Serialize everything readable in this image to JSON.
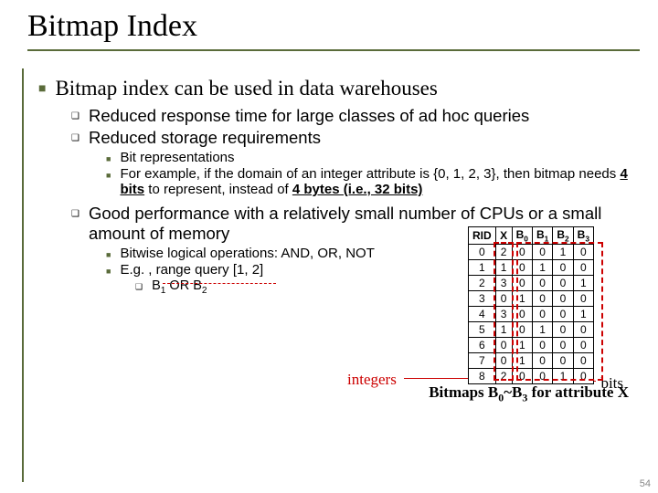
{
  "title": "Bitmap Index",
  "point1": "Bitmap index can be used in data warehouses",
  "sub1": "Reduced response time for large classes of ad hoc queries",
  "sub2": "Reduced storage requirements",
  "sub2a": "Bit representations",
  "sub2b_pre": "For example, if the domain of an integer attribute is {0, 1, 2, 3}, then bitmap needs ",
  "sub2b_mid": "4 bits",
  "sub2b_mid2": " to represent, instead of ",
  "sub2b_end": "4 bytes (i.e., 32 bits)",
  "sub3": "Good performance with a relatively small number of CPUs or a small amount of memory",
  "sub3a": "Bitwise logical operations: AND, OR, NOT",
  "sub3b": "E.g. , range query [1, 2]",
  "sub3b1_pre": "B",
  "sub3b1_or": " OR ",
  "sub3b1_b2": "B",
  "label_integers": "integers",
  "label_bits": "bits",
  "table": {
    "headers": [
      "RID",
      "X",
      "B",
      "B",
      "B",
      "B"
    ],
    "header_subs": [
      "",
      "",
      "0",
      "1",
      "2",
      "3"
    ],
    "rows": [
      [
        "0",
        "2",
        "0",
        "0",
        "1",
        "0"
      ],
      [
        "1",
        "1",
        "0",
        "1",
        "0",
        "0"
      ],
      [
        "2",
        "3",
        "0",
        "0",
        "0",
        "1"
      ],
      [
        "3",
        "0",
        "1",
        "0",
        "0",
        "0"
      ],
      [
        "4",
        "3",
        "0",
        "0",
        "0",
        "1"
      ],
      [
        "5",
        "1",
        "0",
        "1",
        "0",
        "0"
      ],
      [
        "6",
        "0",
        "1",
        "0",
        "0",
        "0"
      ],
      [
        "7",
        "0",
        "1",
        "0",
        "0",
        "0"
      ],
      [
        "8",
        "2",
        "0",
        "0",
        "1",
        "0"
      ]
    ]
  },
  "caption_pre": "Bitmaps B",
  "caption_mid": "~B",
  "caption_end": " for attribute X",
  "pagenum": "54"
}
